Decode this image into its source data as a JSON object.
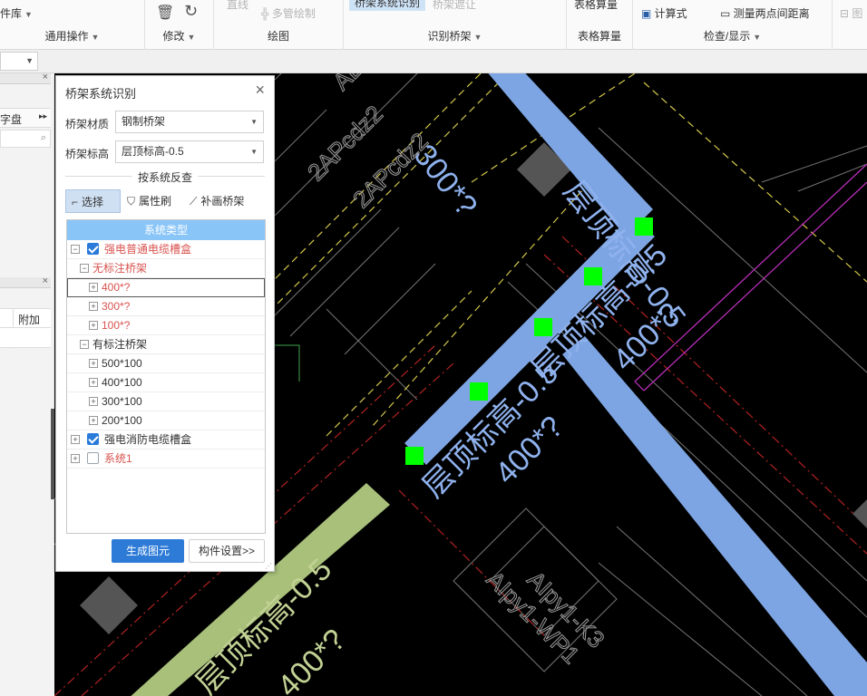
{
  "ribbon": {
    "lib_label": "件库",
    "general_ops": "通用操作",
    "modify": "修改",
    "draw": "绘图",
    "draw_line": "直线",
    "multi_pipe": "多管绘制",
    "tray_recognize_group": "识别桥架",
    "tray_system_recognize": "桥架系统识别",
    "tray_dim": "桥架遮让",
    "table_calc_top": "表格算量",
    "table_calc": "表格算量",
    "calculator": "计算式",
    "measure": "测量两点间距离",
    "check_display": "检查/显示",
    "cut_label": "图"
  },
  "left_panel": {
    "disk_label": "字盘",
    "extra_header": "附加"
  },
  "dialog": {
    "title": "桥架系统识别",
    "material_label": "桥架材质",
    "material_value": "钢制桥架",
    "elevation_label": "桥架标高",
    "elevation_value": "层顶标高-0.5",
    "reverse_check": "按系统反查",
    "tool_select": "选择",
    "tool_brush": "属性刷",
    "tool_addtray": "补画桥架",
    "tree_header": "系统类型",
    "tree": [
      {
        "toggle": "−",
        "checkbox": true,
        "checked": true,
        "label": "强电普通电缆槽盒",
        "red": true,
        "indent": 0
      },
      {
        "toggle": "−",
        "checkbox": false,
        "label": "无标注桥架",
        "red": true,
        "indent": 1
      },
      {
        "toggle": "+",
        "checkbox": false,
        "label": "400*?",
        "red": true,
        "indent": 2,
        "focus": true
      },
      {
        "toggle": "+",
        "checkbox": false,
        "label": "300*?",
        "red": true,
        "indent": 2
      },
      {
        "toggle": "+",
        "checkbox": false,
        "label": "100*?",
        "red": true,
        "indent": 2
      },
      {
        "toggle": "−",
        "checkbox": false,
        "label": "有标注桥架",
        "red": false,
        "indent": 1
      },
      {
        "toggle": "+",
        "checkbox": false,
        "label": "500*100",
        "red": false,
        "indent": 2
      },
      {
        "toggle": "+",
        "checkbox": false,
        "label": "400*100",
        "red": false,
        "indent": 2
      },
      {
        "toggle": "+",
        "checkbox": false,
        "label": "300*100",
        "red": false,
        "indent": 2
      },
      {
        "toggle": "+",
        "checkbox": false,
        "label": "200*100",
        "red": false,
        "indent": 2
      },
      {
        "toggle": "+",
        "checkbox": true,
        "checked": true,
        "label": "强电消防电缆槽盒",
        "red": false,
        "indent": 0
      },
      {
        "toggle": "+",
        "checkbox": true,
        "checked": false,
        "label": "系统1",
        "red": true,
        "indent": 0
      }
    ],
    "btn_generate": "生成图元",
    "btn_component": "构件设置>>"
  },
  "canvas": {
    "tray_label_1": "层顶标高-0.5",
    "tray_size_1": "300*?",
    "tray_label_2": "层顶标高-0.5",
    "tray_size_2": "400*?",
    "tray_label_3": "层顶标高-0.5",
    "tray_size_3": "400*?",
    "tray_label_4": "层顶标高-0.5",
    "tray_size_4": "400*?",
    "cad_text_1": "2APcdz2",
    "cad_text_2": "2APcdz2",
    "cad_text_3": "AL",
    "cad_text_4": "AIpy1-K3",
    "cad_text_5": "AIpy1-WP1",
    "colors": {
      "tray_blue": "#7ea5e3",
      "tray_green": "#a8c07a",
      "grip_green": "#00ff00",
      "dim_red": "#b22222",
      "dim_yellow": "#d4c84a",
      "magenta": "#c030c0"
    }
  }
}
